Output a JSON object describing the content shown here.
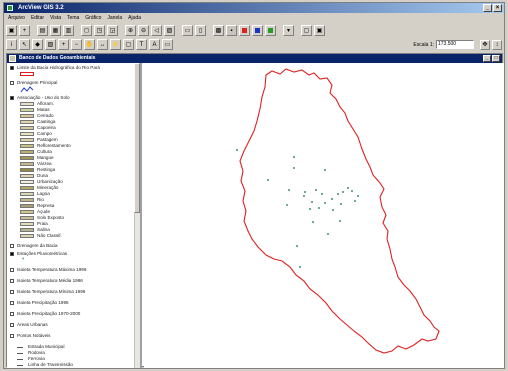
{
  "window": {
    "title": "ArcView GIS 3.2"
  },
  "menu": [
    "Arquivo",
    "Editar",
    "Vista",
    "Tema",
    "Gráfico",
    "Janela",
    "Ajuda"
  ],
  "scale": {
    "label": "Escala 1:",
    "value": "173.500"
  },
  "document": {
    "title": "Banco de Dados Geoambientais"
  },
  "toc": {
    "themes": [
      {
        "name": "Limite da Bacia Hidrográfica do Rio Pará",
        "checked": true,
        "legend": "rect-red"
      },
      {
        "name": "Drenagem Principal",
        "checked": false,
        "legend": "line-blue"
      },
      {
        "name": "Associação - Uso do Solo",
        "checked": true,
        "legend": "classes"
      },
      {
        "name": "Drenagem da Bacia",
        "checked": false
      },
      {
        "name": "Estações Pluviométricas",
        "checked": true
      },
      {
        "name": "Isoieta Temperatura Máxima 1996",
        "checked": false
      },
      {
        "name": "Isoieta Temperatura Média 1996",
        "checked": false
      },
      {
        "name": "Isoieta Temperatura Mínima 1996",
        "checked": false
      },
      {
        "name": "Isoieta Precipitação 1996",
        "checked": false
      },
      {
        "name": "Isoieta Precipitação 1970-2000",
        "checked": false
      },
      {
        "name": "Áreas Urbanas",
        "checked": false
      },
      {
        "name": "Pontos Notáveis",
        "checked": false
      }
    ],
    "classes": [
      {
        "label": "Afloram.",
        "color": "#e8e0c8"
      },
      {
        "label": "Matas",
        "color": "#c8d8a0"
      },
      {
        "label": "Cerrado",
        "color": "#d8c898"
      },
      {
        "label": "Caatinga",
        "color": "#e0d4a8"
      },
      {
        "label": "Capoeira",
        "color": "#d0c8a0"
      },
      {
        "label": "Campo",
        "color": "#e8e4c0"
      },
      {
        "label": "Pastagem",
        "color": "#d8d0a8"
      },
      {
        "label": "Reflorestamento",
        "color": "#c8c080"
      },
      {
        "label": "Cultura",
        "color": "#b8b070"
      },
      {
        "label": "Mangue",
        "color": "#a89858"
      },
      {
        "label": "Várzea",
        "color": "#c8b890"
      },
      {
        "label": "Restinga",
        "color": "#988848"
      },
      {
        "label": "Duna",
        "color": "#e0d0b0"
      },
      {
        "label": "Urbanização",
        "color": "#f0ece0"
      },
      {
        "label": "Mineração",
        "color": "#b8a868"
      },
      {
        "label": "Lagoa",
        "color": "#d8d8b8"
      },
      {
        "label": "Rio",
        "color": "#c0b888"
      },
      {
        "label": "Represa",
        "color": "#a8a070"
      },
      {
        "label": "Açude",
        "color": "#d0c890"
      },
      {
        "label": "Solo Exposto",
        "color": "#c8c098"
      },
      {
        "label": "Praia",
        "color": "#e0dcc0"
      },
      {
        "label": "Salina",
        "color": "#b8b490"
      },
      {
        "label": "Não Classif.",
        "color": "#d8d4b0"
      }
    ],
    "sub_items": [
      "Estrada Municipal",
      "Rodovia",
      "Ferrovia",
      "Linha de Transmissão"
    ]
  },
  "map": {
    "border_color": "#e02020",
    "point_color": "#70a8a0"
  }
}
